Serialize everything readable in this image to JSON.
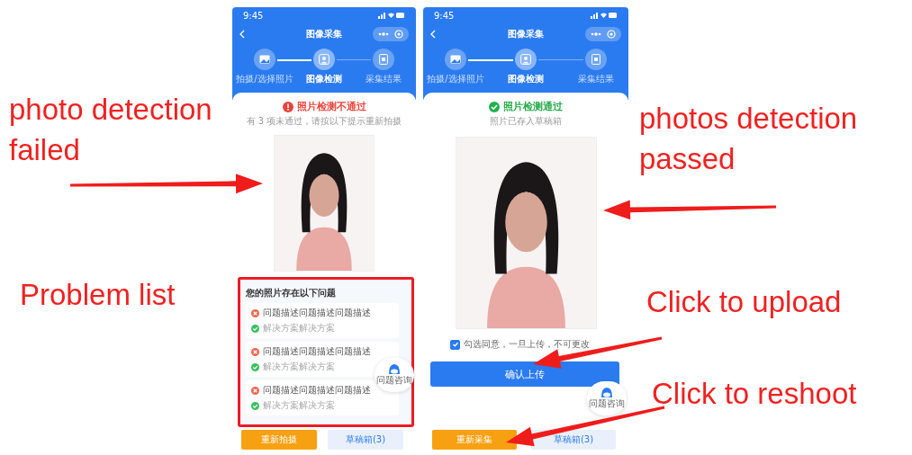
{
  "annotations": [
    {
      "text": "photo detection failed"
    },
    {
      "text": "Problem list"
    },
    {
      "text": "photos detection passed"
    },
    {
      "text": "Click to upload"
    },
    {
      "text": "Click to reshoot"
    }
  ],
  "phones": [
    {
      "kind": "failed",
      "time": "9:45",
      "title": "图像采集",
      "steps": [
        {
          "label": "拍摄/选择照片",
          "selected": false
        },
        {
          "label": "图像检测",
          "selected": true
        },
        {
          "label": "采集结果",
          "selected": false
        }
      ],
      "result": {
        "kind": "failed",
        "heading": "照片检测不通过",
        "subtitle": "有 3 项未通过，请按以下提示重新拍摄"
      },
      "problems": {
        "title": "您的照片存在以下问题",
        "items": [
          {
            "problem": "问题描述问题描述问题描述",
            "solution": "解决方案解决方案"
          },
          {
            "problem": "问题描述问题描述问题描述",
            "solution": "解决方案解决方案"
          },
          {
            "problem": "问题描述问题描述问题描述",
            "solution": "解决方案解决方案"
          }
        ]
      },
      "help_label": "问题咨询",
      "buttons": [
        {
          "label": "重新拍摄",
          "kind": "primary"
        },
        {
          "label": "草稿箱(3)",
          "kind": "secondary"
        }
      ]
    },
    {
      "kind": "passed",
      "time": "9:45",
      "title": "图像采集",
      "steps": [
        {
          "label": "拍摄/选择照片",
          "selected": false
        },
        {
          "label": "图像检测",
          "selected": true
        },
        {
          "label": "采集结果",
          "selected": false
        }
      ],
      "result": {
        "kind": "passed",
        "heading": "照片检测通过",
        "subtitle": "照片已存入草稿箱"
      },
      "consent": {
        "label": "勾选同意，一旦上传，不可更改",
        "checked": true
      },
      "upload_label": "确认上传",
      "help_label": "问题咨询",
      "buttons": [
        {
          "label": "重新采集",
          "kind": "primary"
        },
        {
          "label": "草稿箱(3)",
          "kind": "secondary"
        }
      ]
    }
  ]
}
